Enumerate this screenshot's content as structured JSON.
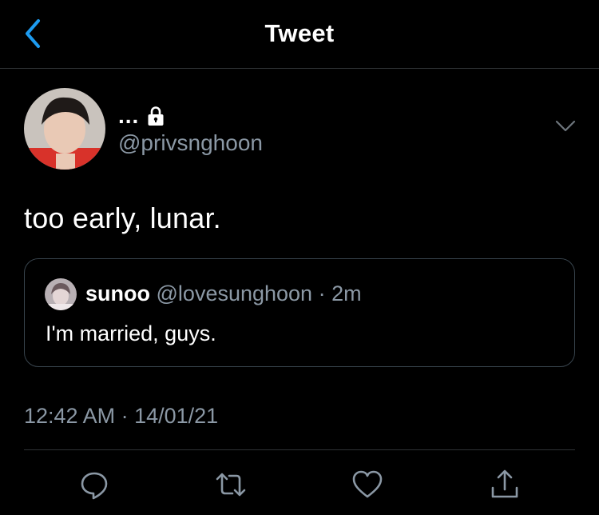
{
  "header": {
    "title": "Tweet"
  },
  "author": {
    "name": "...",
    "handle": "@privsnghoon"
  },
  "tweet": {
    "text": "too early, lunar."
  },
  "quoted": {
    "name": "sunoo",
    "handle": "@lovesunghoon",
    "separator": "·",
    "time": "2m",
    "text": "I'm married, guys."
  },
  "meta": {
    "timestamp": "12:42 AM · 14/01/21"
  },
  "icons": {
    "back": "chevron-left-icon",
    "lock": "lock-icon",
    "menu": "chevron-down-icon",
    "reply": "reply-icon",
    "retweet": "retweet-icon",
    "like": "heart-icon",
    "share": "share-icon"
  },
  "colors": {
    "accent": "#1d9bf0",
    "background": "#000000",
    "secondary_text": "#8b98a5",
    "border": "#2f3336"
  }
}
